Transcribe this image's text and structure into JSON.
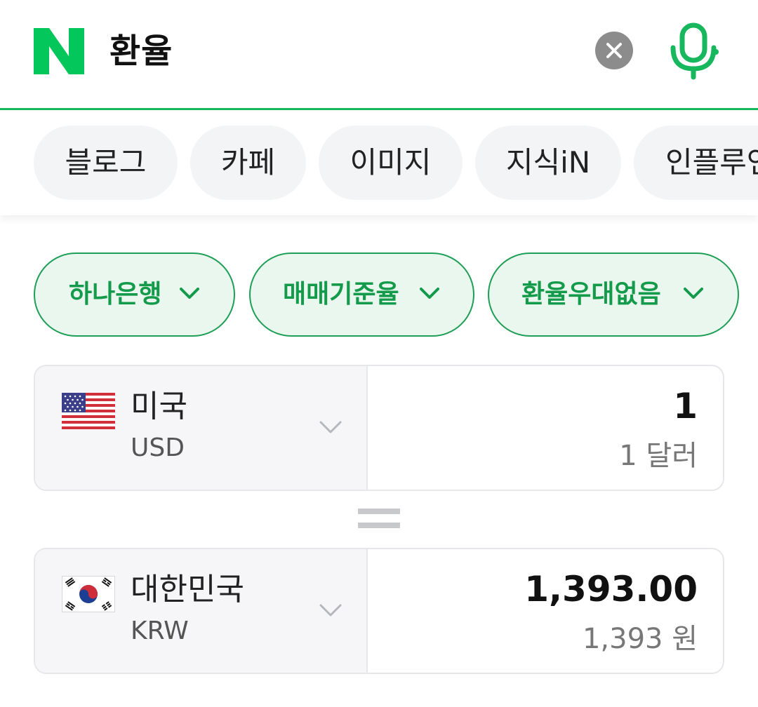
{
  "header": {
    "logo_icon": "naver-n-logo-icon",
    "query": "환율",
    "clear_icon": "close-icon",
    "mic_icon": "microphone-icon",
    "accent_color": "#17b75e"
  },
  "tabs": [
    {
      "label": "블로그"
    },
    {
      "label": "카페"
    },
    {
      "label": "이미지"
    },
    {
      "label": "지식iN"
    },
    {
      "label": "인플루언서"
    }
  ],
  "filters": [
    {
      "label": "하나은행",
      "icon": "chevron-down-icon"
    },
    {
      "label": "매매기준율",
      "icon": "chevron-down-icon"
    },
    {
      "label": "환율우대없음",
      "icon": "chevron-down-icon"
    }
  ],
  "converter": {
    "from": {
      "flag_icon": "us-flag-icon",
      "country": "미국",
      "code": "USD",
      "amount": "1",
      "amount_words": "1 달러"
    },
    "equals_icon": "equals-icon",
    "to": {
      "flag_icon": "kr-flag-icon",
      "country": "대한민국",
      "code": "KRW",
      "amount": "1,393.00",
      "amount_words": "1,393 원"
    }
  }
}
